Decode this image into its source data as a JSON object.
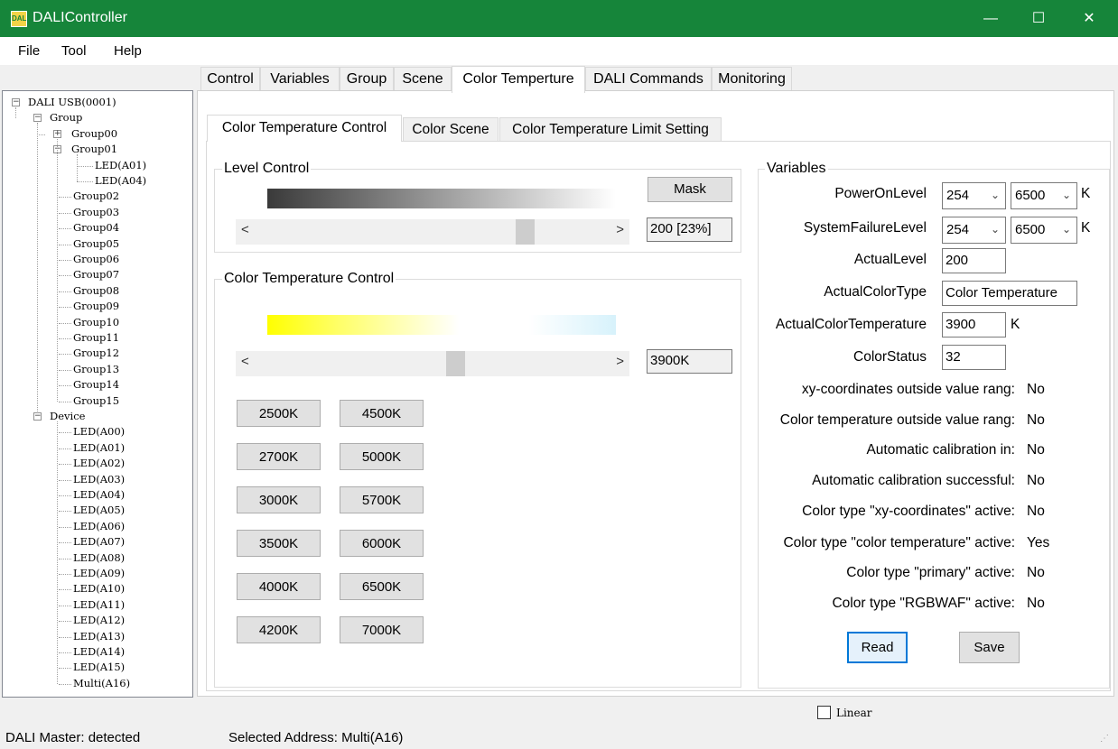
{
  "window": {
    "title": "DALIController",
    "icon": "DALI",
    "minimize": "—",
    "maximize": "☐",
    "close": "✕"
  },
  "menu": [
    "File",
    "Tool",
    "Help"
  ],
  "tree": {
    "root": "DALI USB(0001)",
    "group_label": "Group",
    "group00": "Group00",
    "group01": "Group01",
    "group01_children": [
      "LED(A01)",
      "LED(A04)"
    ],
    "groups": [
      "Group02",
      "Group03",
      "Group04",
      "Group05",
      "Group06",
      "Group07",
      "Group08",
      "Group09",
      "Group10",
      "Group11",
      "Group12",
      "Group13",
      "Group14",
      "Group15"
    ],
    "device_label": "Device",
    "devices": [
      "LED(A00)",
      "LED(A01)",
      "LED(A02)",
      "LED(A03)",
      "LED(A04)",
      "LED(A05)",
      "LED(A06)",
      "LED(A07)",
      "LED(A08)",
      "LED(A09)",
      "LED(A10)",
      "LED(A11)",
      "LED(A12)",
      "LED(A13)",
      "LED(A14)",
      "LED(A15)",
      "Multi(A16)"
    ]
  },
  "main_tabs": [
    "Control",
    "Variables",
    "Group",
    "Scene",
    "Color Temperture",
    "DALI Commands",
    "Monitoring"
  ],
  "sub_tabs": [
    "Color Temperature Control",
    "Color Scene",
    "Color Temperature Limit Setting"
  ],
  "level_control": {
    "title": "Level Control",
    "mask_label": "Mask",
    "value_text": "200 [23%]",
    "slider_fraction": 0.78
  },
  "ct_control": {
    "title": "Color Temperature Control",
    "value_text": "3900K",
    "slider_fraction": 0.57,
    "presets_left": [
      "2500K",
      "2700K",
      "3000K",
      "3500K",
      "4000K",
      "4200K"
    ],
    "presets_right": [
      "4500K",
      "5000K",
      "5700K",
      "6000K",
      "6500K",
      "7000K"
    ]
  },
  "variables": {
    "title": "Variables",
    "power_on_level": {
      "label": "PowerOnLevel",
      "level": "254",
      "temp": "6500",
      "unit": "K"
    },
    "system_failure_level": {
      "label": "SystemFailureLevel",
      "level": "254",
      "temp": "6500",
      "unit": "K"
    },
    "actual_level": {
      "label": "ActualLevel",
      "value": "200"
    },
    "actual_color_type": {
      "label": "ActualColorType",
      "value": "Color Temperature"
    },
    "actual_color_temperature": {
      "label": "ActualColorTemperature",
      "value": "3900",
      "unit": "K"
    },
    "color_status": {
      "label": "ColorStatus",
      "value": "32"
    },
    "status_rows": [
      {
        "label": "xy-coordinates outside value rang:",
        "value": "No"
      },
      {
        "label": "Color temperature outside value rang:",
        "value": "No"
      },
      {
        "label": "Automatic calibration in:",
        "value": "No"
      },
      {
        "label": "Automatic calibration successful:",
        "value": "No"
      },
      {
        "label": "Color type \"xy-coordinates\" active:",
        "value": "No"
      },
      {
        "label": "Color type \"color temperature\" active:",
        "value": "Yes"
      },
      {
        "label": "Color type \"primary\" active:",
        "value": "No"
      },
      {
        "label": "Color type \"RGBWAF\" active:",
        "value": "No"
      }
    ],
    "read_label": "Read",
    "save_label": "Save"
  },
  "linear_label": "Linear",
  "statusbar": {
    "master": "DALI Master: detected",
    "selected": "Selected Address: Multi(A16)"
  }
}
